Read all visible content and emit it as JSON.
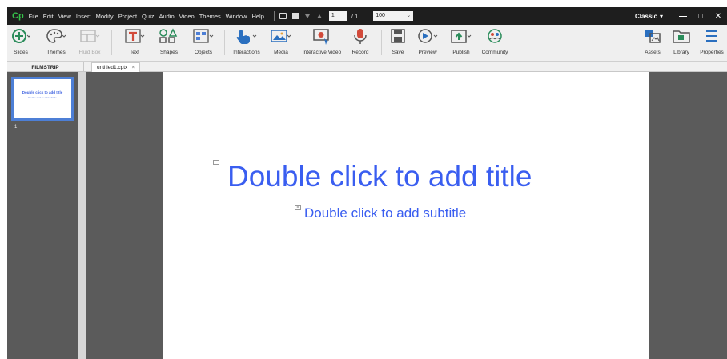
{
  "app": {
    "logo": "Cp"
  },
  "menu": [
    "File",
    "Edit",
    "View",
    "Insert",
    "Modify",
    "Project",
    "Quiz",
    "Audio",
    "Video",
    "Themes",
    "Window",
    "Help"
  ],
  "nav": {
    "current_page": "1",
    "total_pages": "/ 1",
    "zoom": "100",
    "zoom_caret": "⌄"
  },
  "workspace": {
    "label": "Classic",
    "caret": "▾"
  },
  "window_controls": {
    "minimize": "—",
    "restore": "□",
    "close": "✕"
  },
  "toolbar": {
    "slides": "Slides",
    "themes": "Themes",
    "fluid_box": "Fluid Box",
    "text": "Text",
    "shapes": "Shapes",
    "objects": "Objects",
    "interactions": "Interactions",
    "media": "Media",
    "interactive_video": "Interactive Video",
    "record": "Record",
    "save": "Save",
    "preview": "Preview",
    "publish": "Publish",
    "community": "Community",
    "assets": "Assets",
    "library": "Library",
    "properties": "Properties"
  },
  "filmstrip": {
    "header": "FILMSTRIP",
    "thumb_title": "Double click to add title",
    "thumb_subtitle": "Double click to add subtitle",
    "slide_number": "1"
  },
  "tab": {
    "filename": "untitled1.cptx",
    "close": "×"
  },
  "slide": {
    "title_placeholder": "Double click to add title",
    "subtitle_placeholder": "Double click to add subtitle"
  },
  "colors": {
    "accent": "#3a5ef0",
    "menubar": "#1e1e1e",
    "stage": "#5b5b5b",
    "logo": "#35c24a"
  }
}
